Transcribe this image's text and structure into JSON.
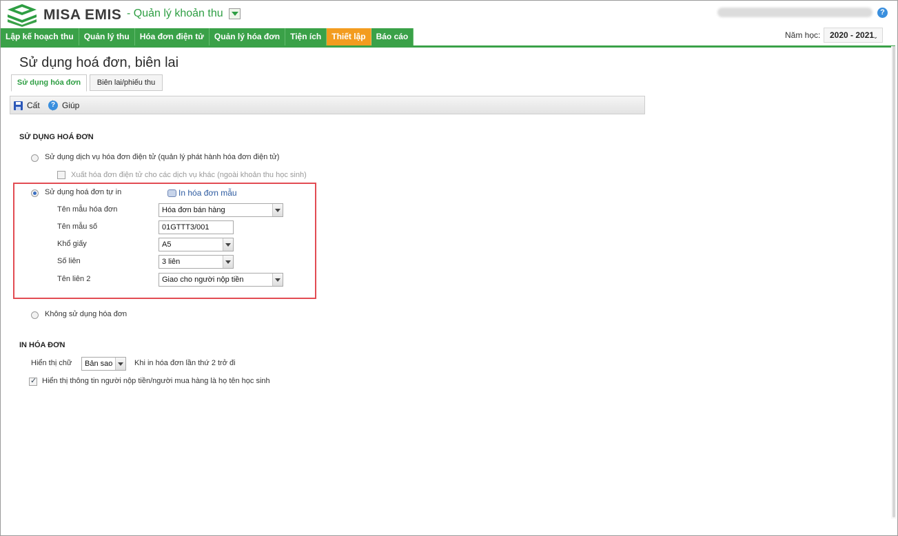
{
  "app": {
    "brand": "MISA EMIS",
    "module": "- Quản lý khoản thu"
  },
  "nav": {
    "items": [
      {
        "label": "Lập kế hoạch thu",
        "active": false
      },
      {
        "label": "Quản lý thu",
        "active": false
      },
      {
        "label": "Hóa đơn điện tử",
        "active": false
      },
      {
        "label": "Quản lý hóa đơn",
        "active": false
      },
      {
        "label": "Tiện ích",
        "active": false
      },
      {
        "label": "Thiết lập",
        "active": true
      },
      {
        "label": "Báo cáo",
        "active": false
      }
    ],
    "year_label": "Năm học:",
    "year_value": "2020 - 2021"
  },
  "colors": {
    "nav_green": "#3aa148",
    "nav_active": "#f39c1f",
    "highlight_border": "#e24b52",
    "link_blue": "#2c5aa0"
  },
  "page": {
    "title": "Sử dụng hoá đơn, biên lai",
    "tabs": [
      "Sử dụng hóa đơn",
      "Biên lai/phiếu thu"
    ],
    "toolbar": {
      "save": "Cất",
      "help": "Giúp"
    }
  },
  "invoice_usage": {
    "section_title": "SỬ DỤNG HOÁ ĐƠN",
    "option_electronic": "Sử dụng dịch vụ hóa đơn điện tử (quản lý phát hành hóa đơn điện tử)",
    "option_electronic_sub": "Xuất hóa đơn điện tử cho các dịch vụ khác (ngoài khoản thu học sinh)",
    "option_self_print": "Sử dụng hoá đơn tự in",
    "print_sample_link": "In hóa đơn mẫu",
    "fields": {
      "template_name_label": "Tên mẫu hóa đơn",
      "template_name_value": "Hóa đơn bán hàng",
      "template_code_label": "Tên mẫu số",
      "template_code_value": "01GTTT3/001",
      "paper_size_label": "Khổ giấy",
      "paper_size_value": "A5",
      "copies_label": "Số liên",
      "copies_value": "3 liên",
      "copy2_name_label": "Tên liên 2",
      "copy2_name_value": "Giao cho người nộp tiền"
    },
    "option_none": "Không sử dụng hóa đơn",
    "selected_option": "self_print"
  },
  "print_invoice": {
    "section_title": "IN HÓA ĐƠN",
    "display_text_label": "Hiển thị chữ",
    "display_text_value": "Bản sao",
    "display_text_note": "Khi in hóa đơn lần thứ 2 trở đi",
    "show_payer_info_label": "Hiển thị thông tin người nộp tiền/người mua hàng là họ tên học sinh",
    "show_payer_info_checked": true
  }
}
